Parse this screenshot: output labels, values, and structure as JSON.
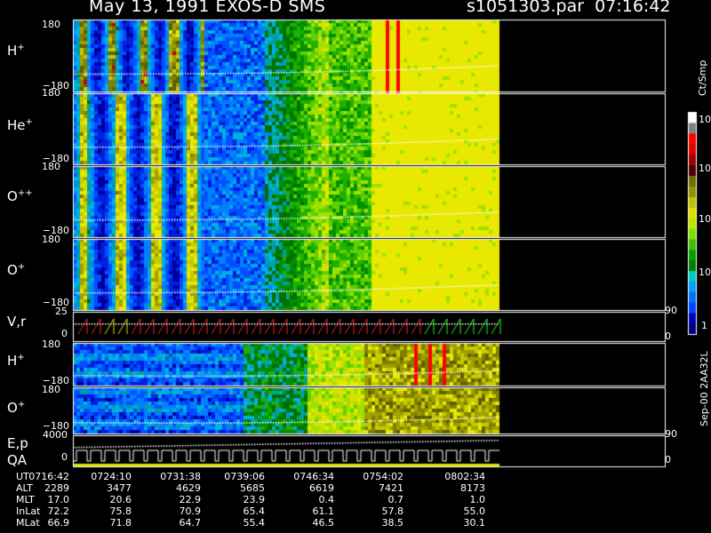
{
  "header": {
    "title": "May 13, 1991   EXOS-D SMS",
    "file": "s1051303.par",
    "time": "07:16:42"
  },
  "panels": {
    "h_plus": {
      "species": "H",
      "charge": "+"
    },
    "he_plus": {
      "species": "He",
      "charge": "+"
    },
    "o_plusplus": {
      "species": "O",
      "charge": "++"
    },
    "o_plus": {
      "species": "O",
      "charge": "+"
    },
    "vr": {
      "label": "V,r"
    },
    "h_plus_2": {
      "species": "H",
      "charge": "+"
    },
    "o_plus_2": {
      "species": "O",
      "charge": "+"
    },
    "ep": {
      "label1": "E,p",
      "label2": "QA"
    }
  },
  "axis_ticks": {
    "angle_top": "180",
    "angle_bottom": "−180",
    "vr_top": "25",
    "vr_bottom": "0",
    "vr_right_top": "90",
    "vr_right_bottom": "0",
    "ep_top": "4000",
    "ep_bottom": "0",
    "ep_right_top": "90",
    "ep_right_bottom": "0"
  },
  "colorbar": {
    "unit": "Ct/Smp",
    "labels": [
      "1",
      "10",
      "100",
      "10³",
      "10⁴"
    ],
    "colors": [
      "#000080",
      "#0000c0",
      "#0040ff",
      "#0070ff",
      "#00a0ff",
      "#00c8c8",
      "#008000",
      "#00a000",
      "#40c000",
      "#80e000",
      "#c0e000",
      "#e0e000",
      "#c0c000",
      "#909000",
      "#707000",
      "#500000",
      "#a00000",
      "#e00000",
      "#ff0000",
      "#808080",
      "#ffffff"
    ]
  },
  "ephemeris": {
    "rows": [
      {
        "name": "UT",
        "values": [
          "0716:42",
          "0724:10",
          "0731:38",
          "0739:06",
          "0746:34",
          "0754:02",
          "0802:34"
        ]
      },
      {
        "name": "ALT",
        "values": [
          "2289",
          "3477",
          "4629",
          "5685",
          "6619",
          "7421",
          "8173"
        ]
      },
      {
        "name": "MLT",
        "values": [
          "17.0",
          "20.6",
          "22.9",
          "23.9",
          "0.4",
          "0.7",
          "1.0"
        ]
      },
      {
        "name": "InLat",
        "values": [
          "72.2",
          "75.8",
          "70.9",
          "65.4",
          "61.1",
          "57.8",
          "55.0"
        ]
      },
      {
        "name": "MLat",
        "values": [
          "66.9",
          "71.8",
          "64.7",
          "55.4",
          "46.5",
          "38.5",
          "30.1"
        ]
      }
    ]
  },
  "version": "Sep-00  2AA32L",
  "chart_data": {
    "type": "heatmap",
    "title": "May 13, 1991   EXOS-D SMS",
    "xlabel": "UT",
    "x_ticks": [
      "0716:42",
      "0724:10",
      "0731:38",
      "0739:06",
      "0746:34",
      "0754:02",
      "0802:34"
    ],
    "panels": [
      "H+",
      "He+",
      "O++",
      "O+",
      "V,r",
      "H+",
      "O+",
      "E,p QA"
    ],
    "angle_ylim": [
      -180,
      180
    ],
    "vr_ylim": [
      0,
      25
    ],
    "ep_ylim": [
      0,
      4000
    ],
    "color_scale": "log",
    "color_range_ct_smp": [
      1,
      10000
    ]
  }
}
